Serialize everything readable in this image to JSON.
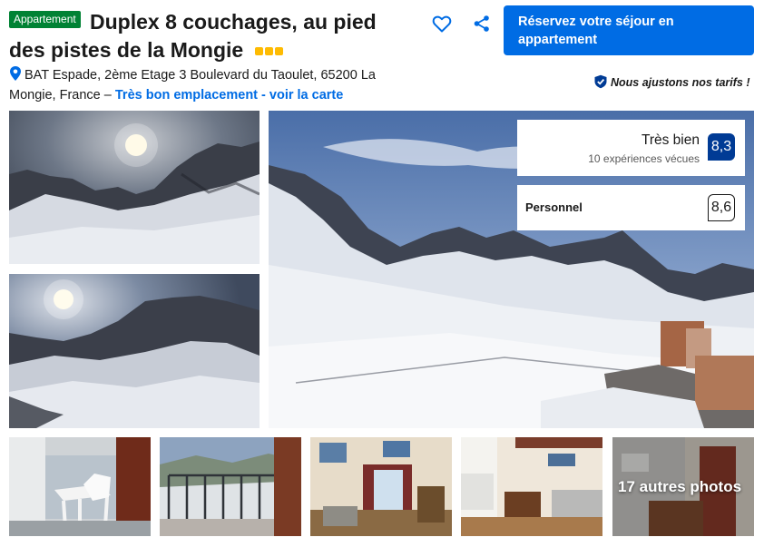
{
  "header": {
    "type_badge": "Appartement",
    "title_line1": "Duplex 8 couchages, au pied",
    "title_line2": "des pistes de la Mongie",
    "stars": 3,
    "reserve_label_line1": "Réservez votre séjour en",
    "reserve_label_line2": "appartement"
  },
  "address": {
    "text": "BAT Espade, 2ème Etage 3 Boulevard du Taoulet, 65200 La Mongie, France –",
    "map_link": "Très bon emplacement - voir la carte"
  },
  "price_match": "Nous ajustons nos tarifs !",
  "rating": {
    "label": "Très bien",
    "reviews": "10 expériences vécues",
    "score": "8,3"
  },
  "staff": {
    "label": "Personnel",
    "score": "8,6"
  },
  "gallery": {
    "more_photos": "17 autres photos"
  },
  "colors": {
    "primary": "#006ce4",
    "badge_green": "#008234",
    "score_dark": "#003b95",
    "star_yellow": "#febb02"
  },
  "icons": [
    "heart-icon",
    "share-icon",
    "map-pin-icon",
    "thumbs-up-check-icon"
  ]
}
